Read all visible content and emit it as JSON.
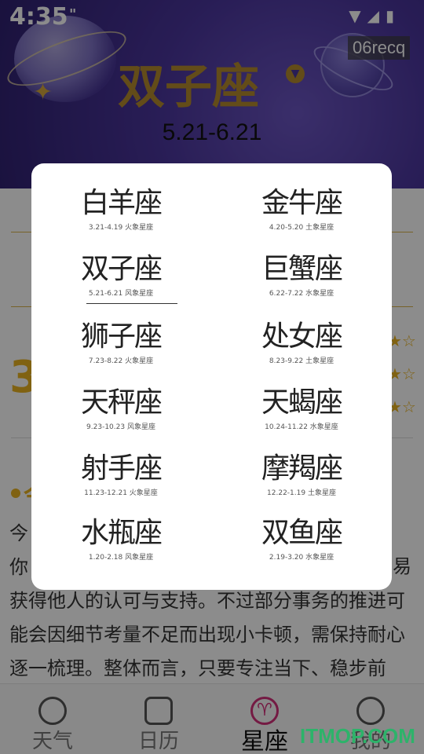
{
  "status_bar": {
    "time": "4:35",
    "extra": "\"",
    "icons": [
      "wifi-icon",
      "signal-icon",
      "battery-icon"
    ]
  },
  "header": {
    "badge": "06recq",
    "title": "双子座",
    "range": "5.21-6.21"
  },
  "dialog": {
    "signs": [
      {
        "name": "白羊座",
        "info": "3.21-4.19 火象星座"
      },
      {
        "name": "金牛座",
        "info": "4.20-5.20 土象星座"
      },
      {
        "name": "双子座",
        "info": "5.21-6.21 风象星座"
      },
      {
        "name": "巨蟹座",
        "info": "6.22-7.22 水象星座"
      },
      {
        "name": "狮子座",
        "info": "7.23-8.22 火象星座"
      },
      {
        "name": "处女座",
        "info": "8.23-9.22 土象星座"
      },
      {
        "name": "天秤座",
        "info": "9.23-10.23 风象星座"
      },
      {
        "name": "天蝎座",
        "info": "10.24-11.22 水象星座"
      },
      {
        "name": "射手座",
        "info": "11.23-12.21 火象星座"
      },
      {
        "name": "摩羯座",
        "info": "12.22-1.19 土象星座"
      },
      {
        "name": "水瓶座",
        "info": "1.20-2.18 风象星座"
      },
      {
        "name": "双鱼座",
        "info": "2.19-3.20 水象星座"
      }
    ],
    "selected": "双子座"
  },
  "page": {
    "big_number": "3",
    "section_title": "今",
    "fortune_lines": [
      "今",
      "你",
      "获得他人的认可与支持。不过部分事务的推进可",
      "能会因细节考量不足而出现小卡顿，需保持耐心",
      "逐一梳理。整体而言，只要专注当下、稳步前"
    ],
    "fortune_right": "易"
  },
  "tabbar": {
    "tabs": [
      {
        "label": "天气",
        "icon": "face-cloud-icon"
      },
      {
        "label": "日历",
        "icon": "calendar-icon"
      },
      {
        "label": "星座",
        "icon": "aries-icon"
      },
      {
        "label": "我的",
        "icon": "smiley-icon"
      }
    ],
    "active": "星座"
  },
  "watermark": "ITMOP.COM",
  "colors": {
    "accent": "#e9b321",
    "title_gold": "#b48a2e",
    "header_purple": "#4a359c",
    "active_tab": "#d4317a"
  }
}
